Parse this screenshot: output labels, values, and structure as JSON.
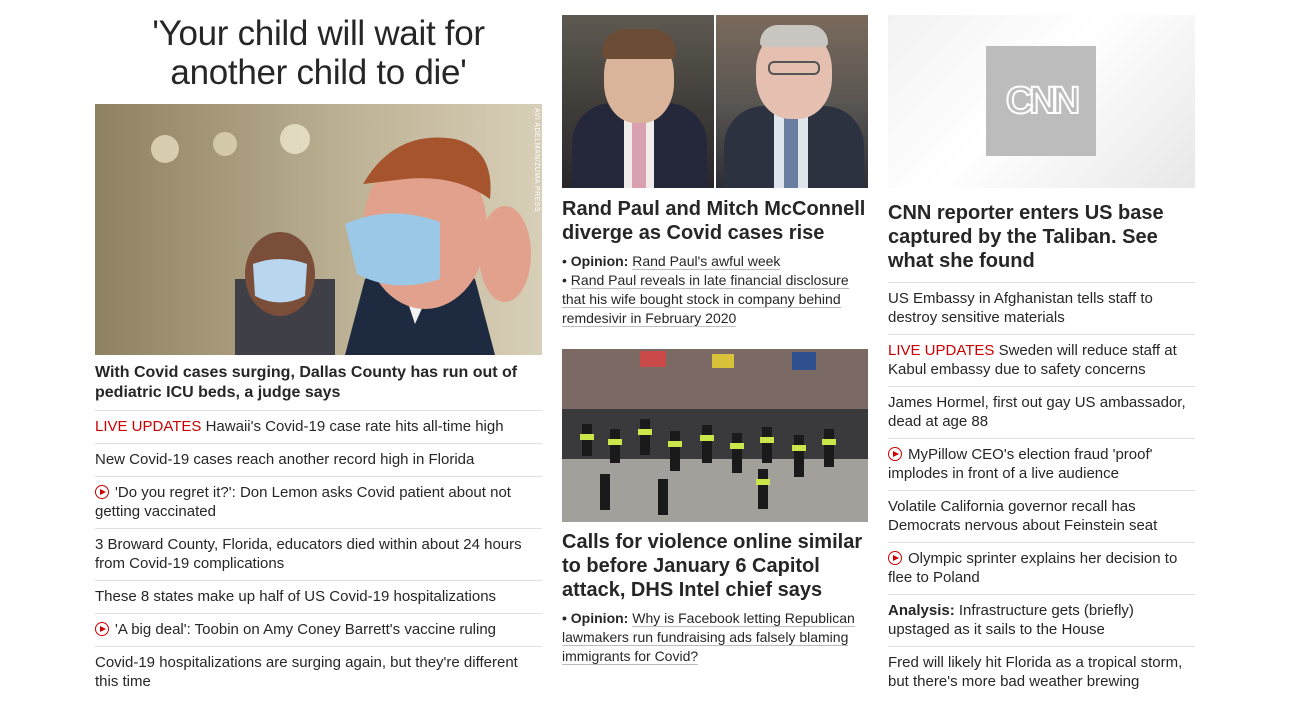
{
  "col1": {
    "headline": "'Your child will wait for another child to die'",
    "image_credit": "AVI ADELMAN/ZUMA PRESS",
    "lead": "With Covid cases surging, Dallas County has run out of pediatric ICU beds, a judge says",
    "items": [
      {
        "prefix": "LIVE UPDATES",
        "text": " Hawaii's Covid-19 case rate hits all-time high"
      },
      {
        "text": "New Covid-19 cases reach another record high in Florida"
      },
      {
        "text": "'Do you regret it?': Don Lemon asks Covid patient about not getting vaccinated",
        "video": true
      },
      {
        "text": "3 Broward County, Florida, educators died within about 24 hours from Covid-19 complications"
      },
      {
        "text": "These 8 states make up half of US Covid-19 hospitalizations"
      },
      {
        "text": "'A big deal': Toobin on Amy Coney Barrett's vaccine ruling",
        "video": true
      },
      {
        "text": "Covid-19 hospitalizations are surging again, but they're different this time"
      }
    ]
  },
  "col2": {
    "story1": {
      "title": "Rand Paul and Mitch McConnell diverge as Covid cases rise",
      "bullet1_label": "Opinion:",
      "bullet1_link": "Rand Paul's awful week",
      "bullet2_link": "Rand Paul reveals in late financial disclosure that his wife bought stock in company behind remdesivir in February 2020"
    },
    "story2": {
      "title": "Calls for violence online similar to before January 6 Capitol attack, DHS Intel chief says",
      "bullet_label": "Opinion:",
      "bullet_link": "Why is Facebook letting Republican lawmakers run fundraising ads falsely blaming immigrants for Covid?"
    }
  },
  "col3": {
    "logo_text": "CNN",
    "title": "CNN reporter enters US base captured by the Taliban. See what she found",
    "items": [
      {
        "text": "US Embassy in Afghanistan tells staff to destroy sensitive materials"
      },
      {
        "prefix": "LIVE UPDATES",
        "text": " Sweden will reduce staff at Kabul embassy due to safety concerns"
      },
      {
        "text": "James Hormel, first out gay US ambassador, dead at age 88"
      },
      {
        "text": "MyPillow CEO's election fraud 'proof' implodes in front of a live audience",
        "video": true
      },
      {
        "text": "Volatile California governor recall has Democrats nervous about Feinstein seat"
      },
      {
        "text": "Olympic sprinter explains her decision to flee to Poland",
        "video": true
      },
      {
        "bold_prefix": "Analysis:",
        "text": " Infrastructure gets (briefly) upstaged as it sails to the House"
      },
      {
        "text": "Fred will likely hit Florida as a tropical storm, but there's more bad weather brewing"
      }
    ]
  }
}
